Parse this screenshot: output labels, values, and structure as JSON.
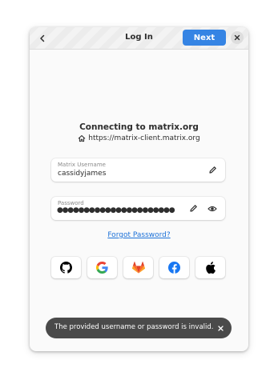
{
  "header": {
    "title": "Log In",
    "next_label": "Next",
    "back_icon": "go-previous-icon",
    "close_icon": "window-close-icon"
  },
  "connect": {
    "title": "Connecting to matrix.org",
    "homeserver_url": "https://matrix-client.matrix.org",
    "home_icon": "home-icon"
  },
  "username_field": {
    "label": "Matrix Username",
    "value": "cassidyjames",
    "edit_icon": "pencil-icon"
  },
  "password_field": {
    "label": "Password",
    "value_masked": "●●●●●●●●●●●●●●●●●●●●●●",
    "edit_icon": "pencil-icon",
    "reveal_icon": "eye-icon"
  },
  "forgot_password": "Forgot Password?",
  "sso_providers": [
    {
      "name": "GitHub",
      "icon": "github-icon",
      "color": "#000000"
    },
    {
      "name": "Google",
      "icon": "google-icon",
      "color": "#4285f4"
    },
    {
      "name": "GitLab",
      "icon": "gitlab-icon",
      "color": "#fc6d26"
    },
    {
      "name": "Facebook",
      "icon": "facebook-icon",
      "color": "#1877f2"
    },
    {
      "name": "Apple",
      "icon": "apple-icon",
      "color": "#000000"
    }
  ],
  "toast": {
    "message": "The provided username or password is invalid.",
    "close_icon": "close-icon"
  },
  "colors": {
    "accent": "#3584e4",
    "link": "#1c71d8",
    "toast_bg": "#4a4a4a"
  }
}
